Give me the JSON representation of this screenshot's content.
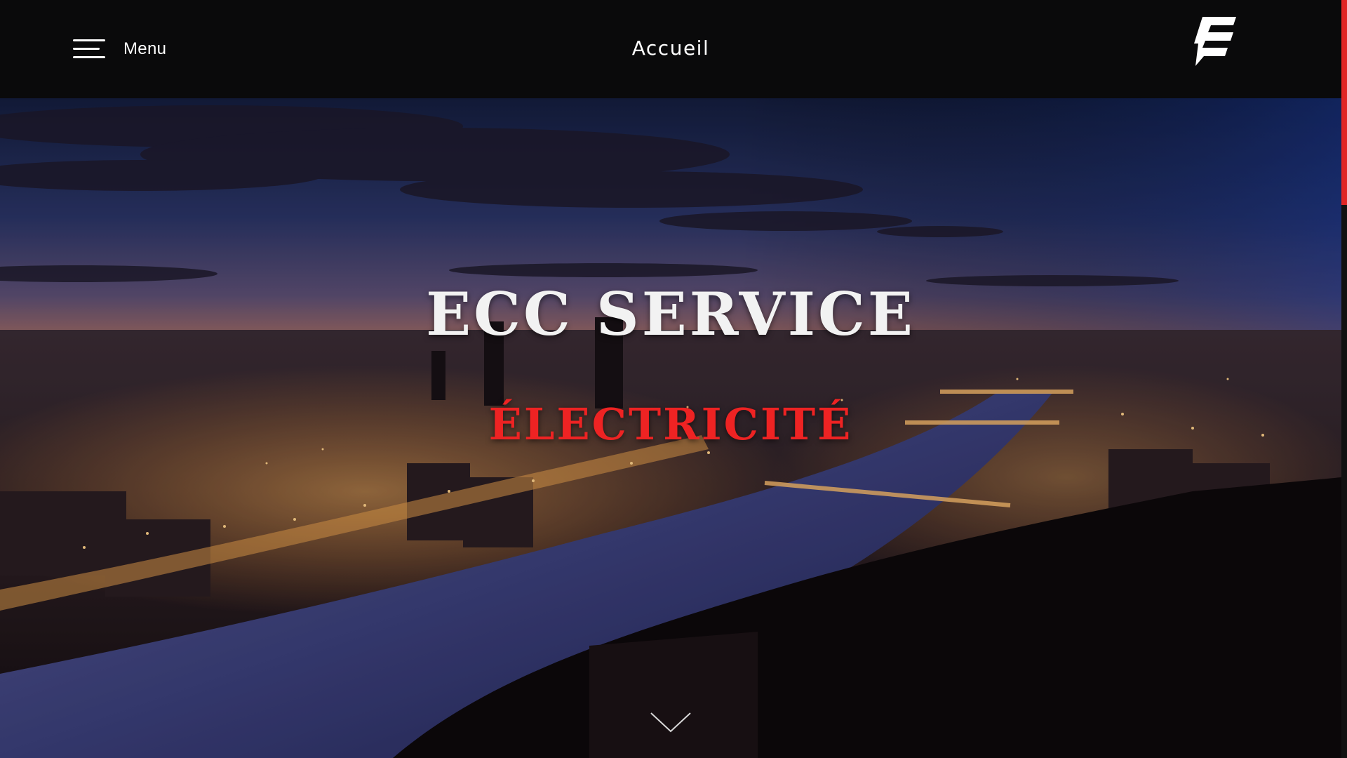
{
  "header": {
    "menu_label": "Menu",
    "menu_icon": "hamburger-icon",
    "title": "Accueil",
    "logo_icon": "ecc-logo-icon"
  },
  "hero": {
    "title": "ECC SERVICE",
    "subtitle": "ÉLECTRICITÉ",
    "background": "lyon-night-cityscape-photo",
    "scroll_icon": "chevron-down-icon"
  },
  "colors": {
    "header_bg": "#0a0a0b",
    "accent_red": "#ee2323",
    "title_white": "#f2f2f2",
    "scroll_thumb": "#e02525"
  }
}
